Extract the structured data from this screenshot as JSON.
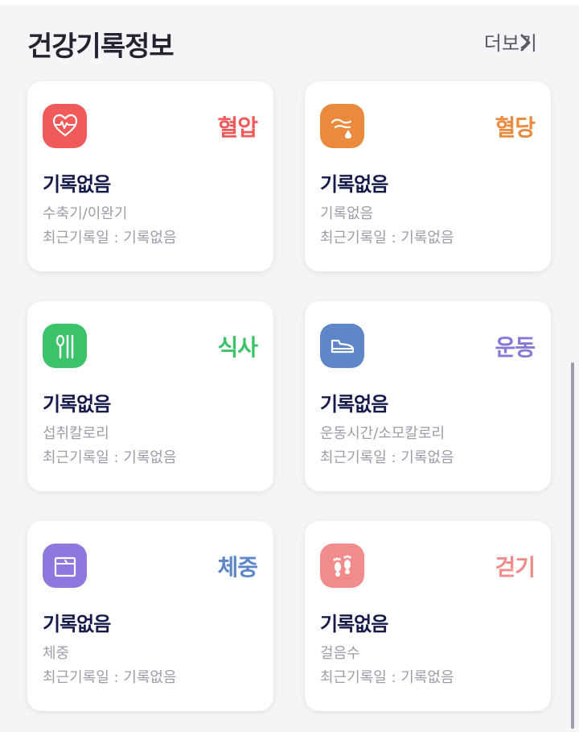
{
  "header": {
    "title": "건강기록정보",
    "more": "더보기"
  },
  "cards": [
    {
      "title": "혈압",
      "status": "기록없음",
      "sub": "수축기/이완기",
      "last": "최근기록일 : 기록없음",
      "color": "#ef5b5b",
      "icon": "heart-rate-icon"
    },
    {
      "title": "혈당",
      "status": "기록없음",
      "sub": "기록없음",
      "last": "최근기록일 : 기록없음",
      "color": "#ea8a3f",
      "icon": "blood-drop-icon"
    },
    {
      "title": "식사",
      "status": "기록없음",
      "sub": "섭취칼로리",
      "last": "최근기록일 : 기록없음",
      "color": "#3cc36a",
      "icon": "utensils-icon"
    },
    {
      "title": "운동",
      "status": "기록없음",
      "sub": "운동시간/소모칼로리",
      "last": "최근기록일 : 기록없음",
      "color": "#5f86c9",
      "titleColor": "#8a77d8",
      "icon": "shoe-icon"
    },
    {
      "title": "체중",
      "status": "기록없음",
      "sub": "체중",
      "last": "최근기록일 : 기록없음",
      "color": "#8f78dd",
      "titleColor": "#5f86c9",
      "icon": "scale-icon"
    },
    {
      "title": "걷기",
      "status": "기록없음",
      "sub": "걸음수",
      "last": "최근기록일 : 기록없음",
      "color": "#f28b8b",
      "icon": "footprints-icon"
    }
  ]
}
